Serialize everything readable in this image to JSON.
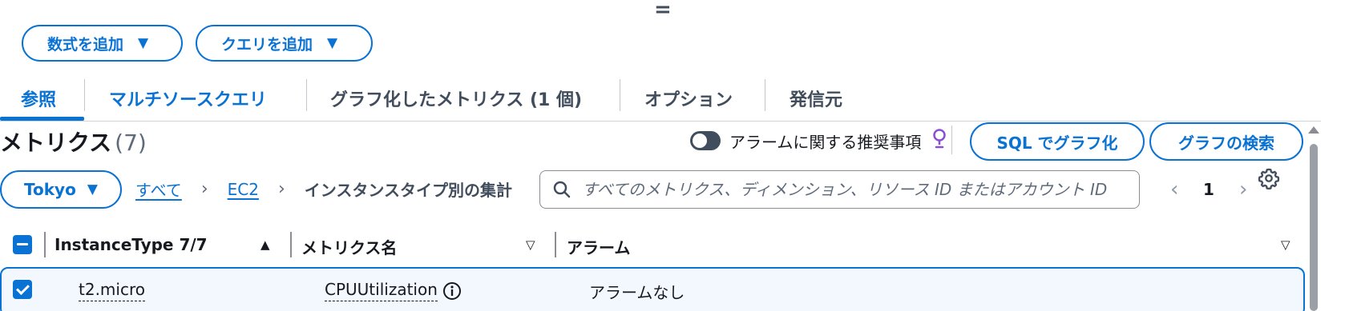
{
  "handle": "=",
  "add_buttons": {
    "formula": "数式を追加",
    "query": "クエリを追加"
  },
  "tabs": [
    {
      "label": "参照",
      "active": true
    },
    {
      "label": "マルチソースクエリ"
    },
    {
      "label": "グラフ化したメトリクス (1 個)"
    },
    {
      "label": "オプション"
    },
    {
      "label": "発信元"
    }
  ],
  "metrics": {
    "title": "メトリクス",
    "count": "(7)"
  },
  "alarm_toggle": {
    "label": "アラームに関する推奨事項",
    "on": false
  },
  "buttons": {
    "sql": "SQL でグラフ化",
    "search": "グラフの検索"
  },
  "region": "Tokyo",
  "breadcrumb": {
    "all": "すべて",
    "namespace": "EC2",
    "current": "インスタンスタイプ別の集計"
  },
  "search": {
    "placeholder": "すべてのメトリクス、ディメンション、リソース ID またはアカウント ID"
  },
  "pagination": {
    "page": "1"
  },
  "table": {
    "columns": {
      "instance_type": "InstanceType 7/7",
      "metric_name": "メトリクス名",
      "alarm": "アラーム"
    },
    "rows": [
      {
        "instance_type": "t2.micro",
        "metric_name": "CPUUtilization",
        "alarm": "アラームなし",
        "selected": true
      }
    ]
  },
  "colors": {
    "accent": "#0972d3",
    "text": "#16191f",
    "secondary": "#414d5c",
    "bulb": "#8a4fd6"
  }
}
